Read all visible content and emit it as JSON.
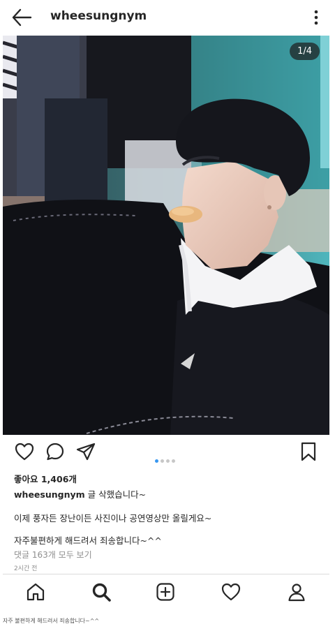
{
  "header": {
    "username": "wheesungnym"
  },
  "post": {
    "counter": "1/4",
    "likes": "좋아요 1,406개",
    "caption_user": "wheesungnym",
    "caption_text": "글 삭했습니다~",
    "line1": "이제 풍자든 장난이든 사진이나 공연영상만 올릴게요~",
    "line2": "자주불편하게 해드려서 죄송합니다~^^",
    "comments": "댓글 163개 모두 보기",
    "time": "2시간 전",
    "carousel_index": 1,
    "carousel_total": 4
  },
  "footer_caption": "자주 불편하게 해드려서 죄송합니다~^^",
  "colors": {
    "accent": "#3897f0",
    "text": "#262626",
    "muted": "#8e8e8e"
  },
  "icons": [
    "back-arrow-icon",
    "more-vertical-icon",
    "heart-icon",
    "comment-icon",
    "share-icon",
    "bookmark-icon",
    "home-icon",
    "search-icon",
    "add-icon",
    "activity-heart-icon",
    "profile-icon"
  ]
}
